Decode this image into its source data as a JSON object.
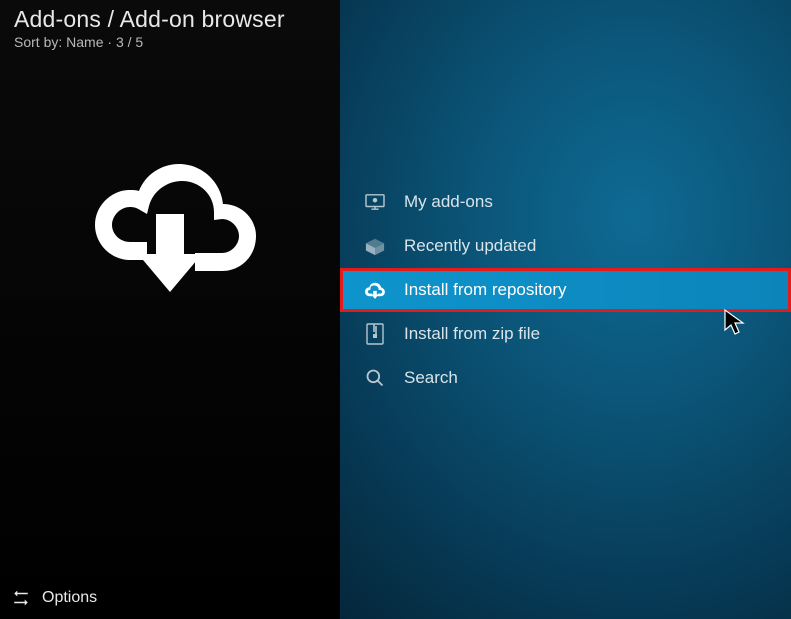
{
  "header": {
    "breadcrumb": "Add-ons / Add-on browser",
    "sort_label": "Sort by:",
    "sort_value": "Name",
    "position": "3 / 5"
  },
  "menu": {
    "items": [
      {
        "label": "My add-ons",
        "icon": "screen-icon"
      },
      {
        "label": "Recently updated",
        "icon": "box-open-icon"
      },
      {
        "label": "Install from repository",
        "icon": "cloud-download-icon",
        "selected": true,
        "highlighted": true
      },
      {
        "label": "Install from zip file",
        "icon": "zip-icon"
      },
      {
        "label": "Search",
        "icon": "search-icon"
      }
    ]
  },
  "footer": {
    "options_label": "Options"
  }
}
